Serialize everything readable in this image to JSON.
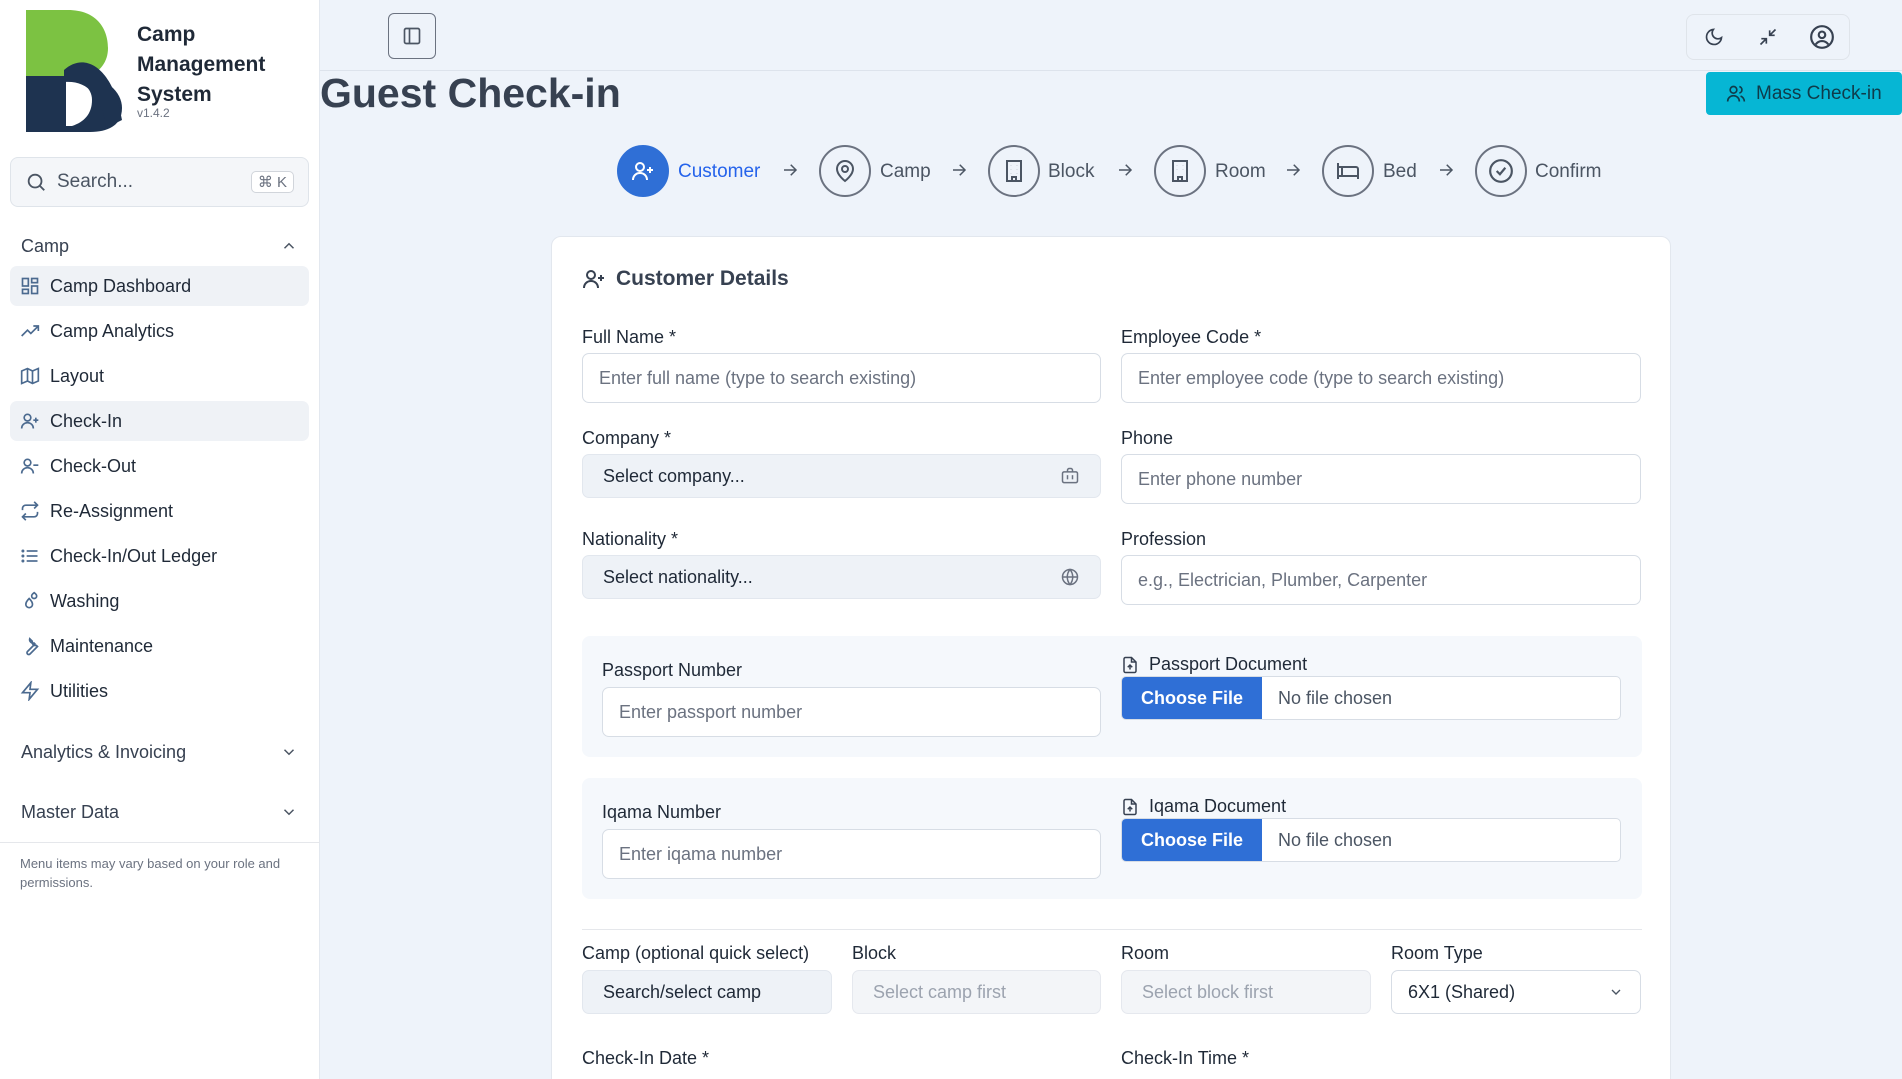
{
  "app": {
    "name": "Camp Management System",
    "version": "v1.4.2"
  },
  "search": {
    "placeholder": "Search...",
    "shortcut": "⌘ K"
  },
  "sidebar": {
    "camp_section": "Camp",
    "items": [
      {
        "label": "Camp Dashboard",
        "icon": "dashboard-icon"
      },
      {
        "label": "Camp Analytics",
        "icon": "trending-up-icon"
      },
      {
        "label": "Layout",
        "icon": "map-icon"
      },
      {
        "label": "Check-In",
        "icon": "user-plus-icon"
      },
      {
        "label": "Check-Out",
        "icon": "user-minus-icon"
      },
      {
        "label": "Re-Assignment",
        "icon": "repeat-icon"
      },
      {
        "label": "Check-In/Out Ledger",
        "icon": "list-icon"
      },
      {
        "label": "Washing",
        "icon": "droplets-icon"
      },
      {
        "label": "Maintenance",
        "icon": "wrench-icon"
      },
      {
        "label": "Utilities",
        "icon": "zap-icon"
      }
    ],
    "analytics_section": "Analytics & Invoicing",
    "master_section": "Master Data",
    "footnote": "Menu items may vary based on your role and permissions."
  },
  "page": {
    "title": "Guest Check-in",
    "mass_button": "Mass Check-in"
  },
  "steps": [
    "Customer",
    "Camp",
    "Block",
    "Room",
    "Bed",
    "Confirm"
  ],
  "form": {
    "title": "Customer Details",
    "full_name": {
      "label": "Full Name *",
      "placeholder": "Enter full name (type to search existing)"
    },
    "employee_code": {
      "label": "Employee Code *",
      "placeholder": "Enter employee code (type to search existing)"
    },
    "company": {
      "label": "Company *",
      "value": "Select company..."
    },
    "phone": {
      "label": "Phone",
      "placeholder": "Enter phone number"
    },
    "nationality": {
      "label": "Nationality *",
      "value": "Select nationality..."
    },
    "profession": {
      "label": "Profession",
      "placeholder": "e.g., Electrician, Plumber, Carpenter"
    },
    "passport_number": {
      "label": "Passport Number",
      "placeholder": "Enter passport number"
    },
    "passport_document": {
      "label": "Passport Document",
      "button": "Choose File",
      "status": "No file chosen"
    },
    "iqama_number": {
      "label": "Iqama Number",
      "placeholder": "Enter iqama number"
    },
    "iqama_document": {
      "label": "Iqama Document",
      "button": "Choose File",
      "status": "No file chosen"
    },
    "camp": {
      "label": "Camp (optional quick select)",
      "value": "Search/select camp"
    },
    "block": {
      "label": "Block",
      "value": "Select camp first"
    },
    "room": {
      "label": "Room",
      "value": "Select block first"
    },
    "room_type": {
      "label": "Room Type",
      "value": "6X1 (Shared)"
    },
    "checkin_date": {
      "label": "Check-In Date *"
    },
    "checkin_time": {
      "label": "Check-In Time *"
    }
  },
  "colors": {
    "accent": "#2f6fd6",
    "mass_button": "#06b6d4",
    "logo_green": "#7cc242",
    "logo_navy": "#1e3350"
  }
}
